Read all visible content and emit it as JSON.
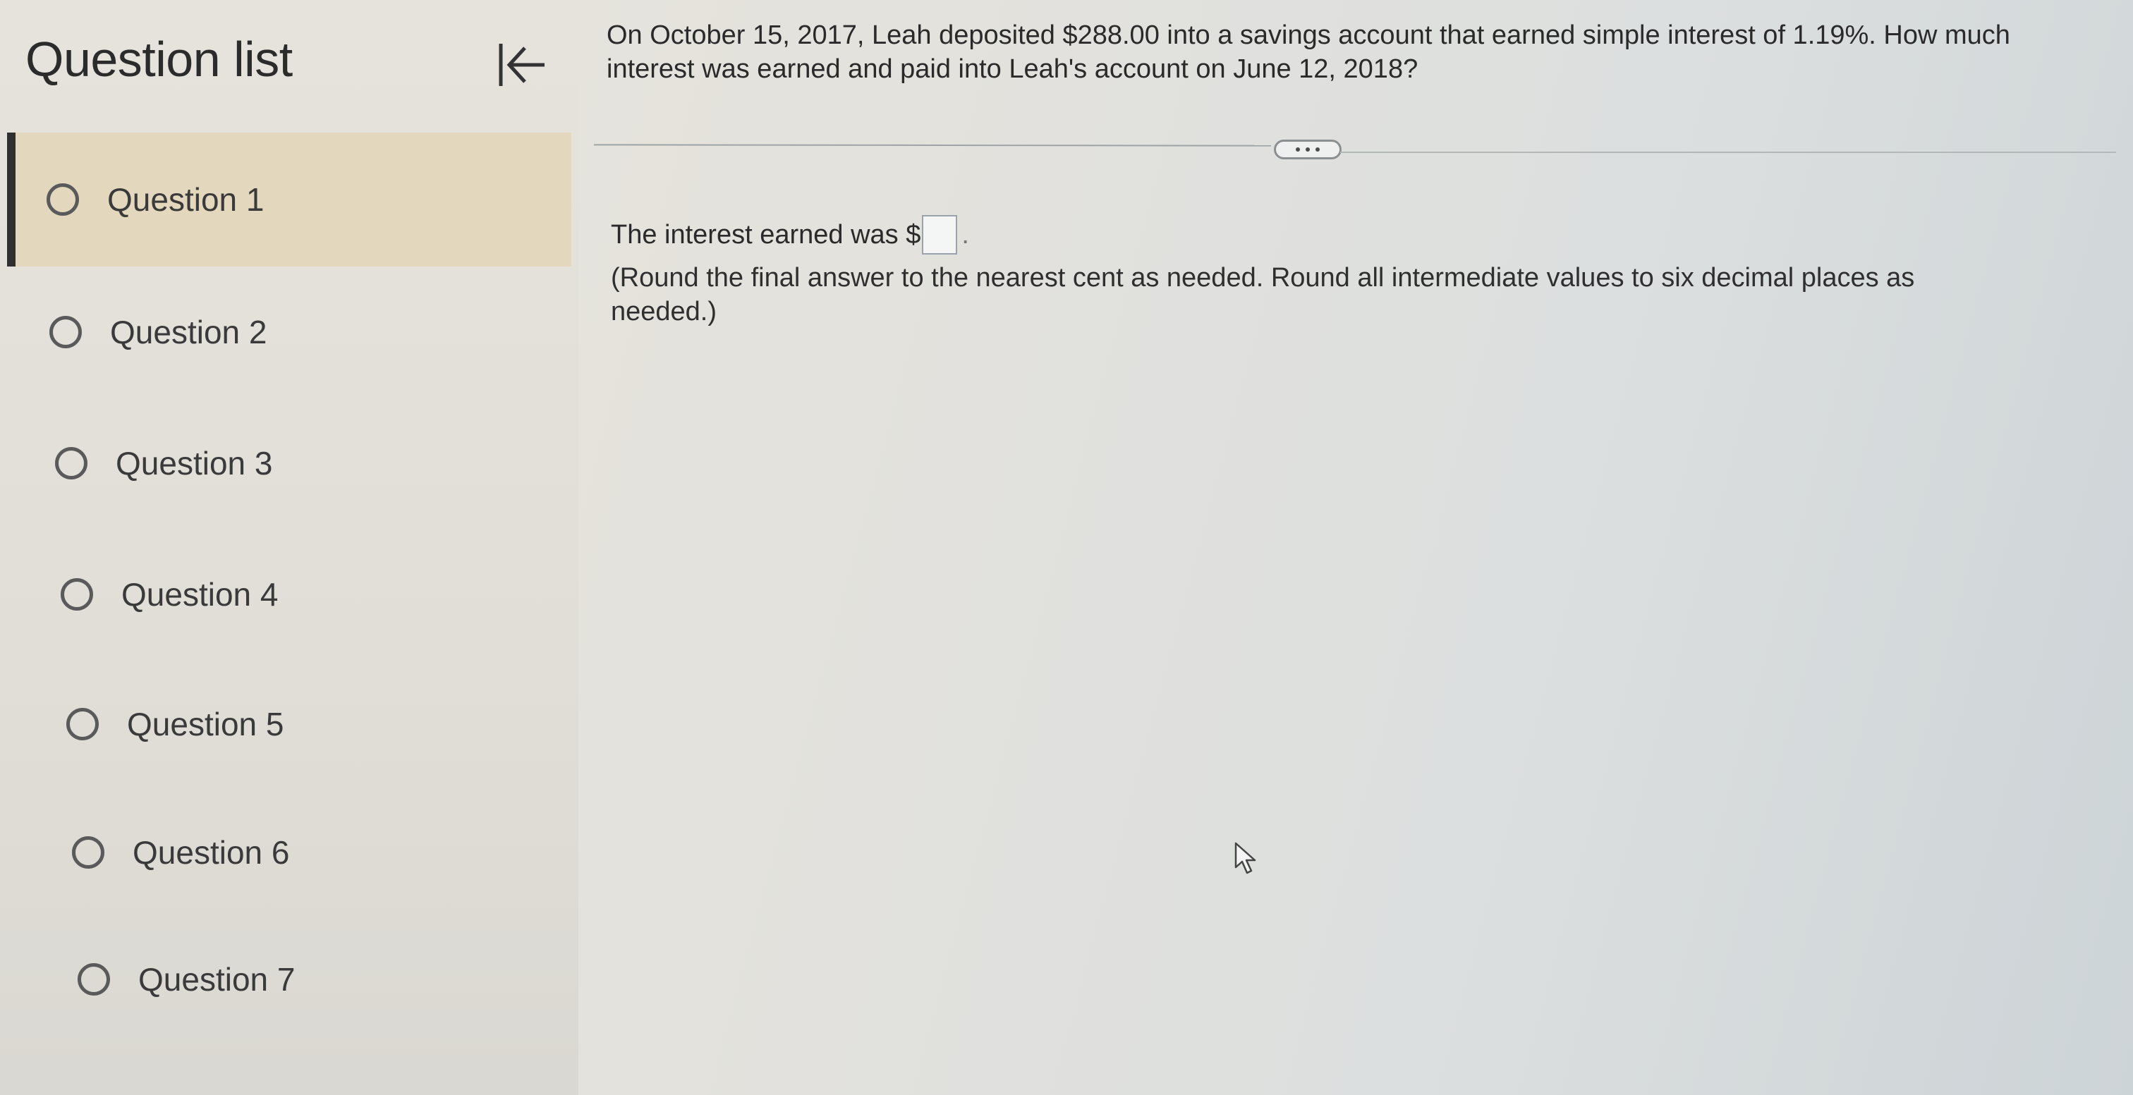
{
  "sidebar": {
    "title": "Question list",
    "collapse_icon": "collapse-left-arrow-icon",
    "questions": [
      {
        "label": "Question 1"
      },
      {
        "label": "Question 2"
      },
      {
        "label": "Question 3"
      },
      {
        "label": "Question 4"
      },
      {
        "label": "Question 5"
      },
      {
        "label": "Question 6"
      },
      {
        "label": "Question 7"
      }
    ]
  },
  "main": {
    "question": "On October 15, 2017, Leah deposited $288.00 into a savings account that earned simple interest of 1.19%. How much interest was earned and paid into Leah's account on June 12, 2018?",
    "more_icon": "more-dots-icon",
    "answer_prefix": "The interest earned was $",
    "answer_value": "",
    "answer_suffix": ".",
    "instructions": "(Round the final answer to the nearest cent as needed. Round all intermediate values to six decimal places as needed.)"
  },
  "colors": {
    "active_item_bg": "#e3d8bd",
    "active_item_bar": "#2f2f2f"
  }
}
